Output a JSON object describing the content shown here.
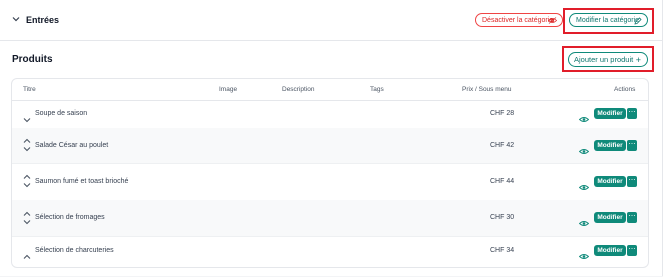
{
  "category": {
    "title": "Entrées",
    "deactivate_label": "Désactiver la catégorie",
    "edit_label": "Modifier la catégorie"
  },
  "products": {
    "section_title": "Produits",
    "add_label": "Ajouter un produit",
    "columns": {
      "title": "Titre",
      "image": "Image",
      "description": "Description",
      "tags": "Tags",
      "price": "Prix / Sous menu",
      "actions": "Actions"
    },
    "rows": [
      {
        "name": "Soupe de saison",
        "price": "CHF 28",
        "edit": "Modifier",
        "more": "⋯"
      },
      {
        "name": "Salade César au poulet",
        "price": "CHF 42",
        "edit": "Modifier",
        "more": "⋯"
      },
      {
        "name": "Saumon fumé et toast brioché",
        "price": "CHF 44",
        "edit": "Modifier",
        "more": "⋯"
      },
      {
        "name": "Sélection de fromages",
        "price": "CHF 30",
        "edit": "Modifier",
        "more": "⋯"
      },
      {
        "name": "Sélection de charcuteries",
        "price": "CHF 34",
        "edit": "Modifier",
        "more": "⋯"
      }
    ]
  },
  "colors": {
    "accent": "#0f8a7a",
    "danger": "#dc2626",
    "highlight": "#e11d2a"
  }
}
